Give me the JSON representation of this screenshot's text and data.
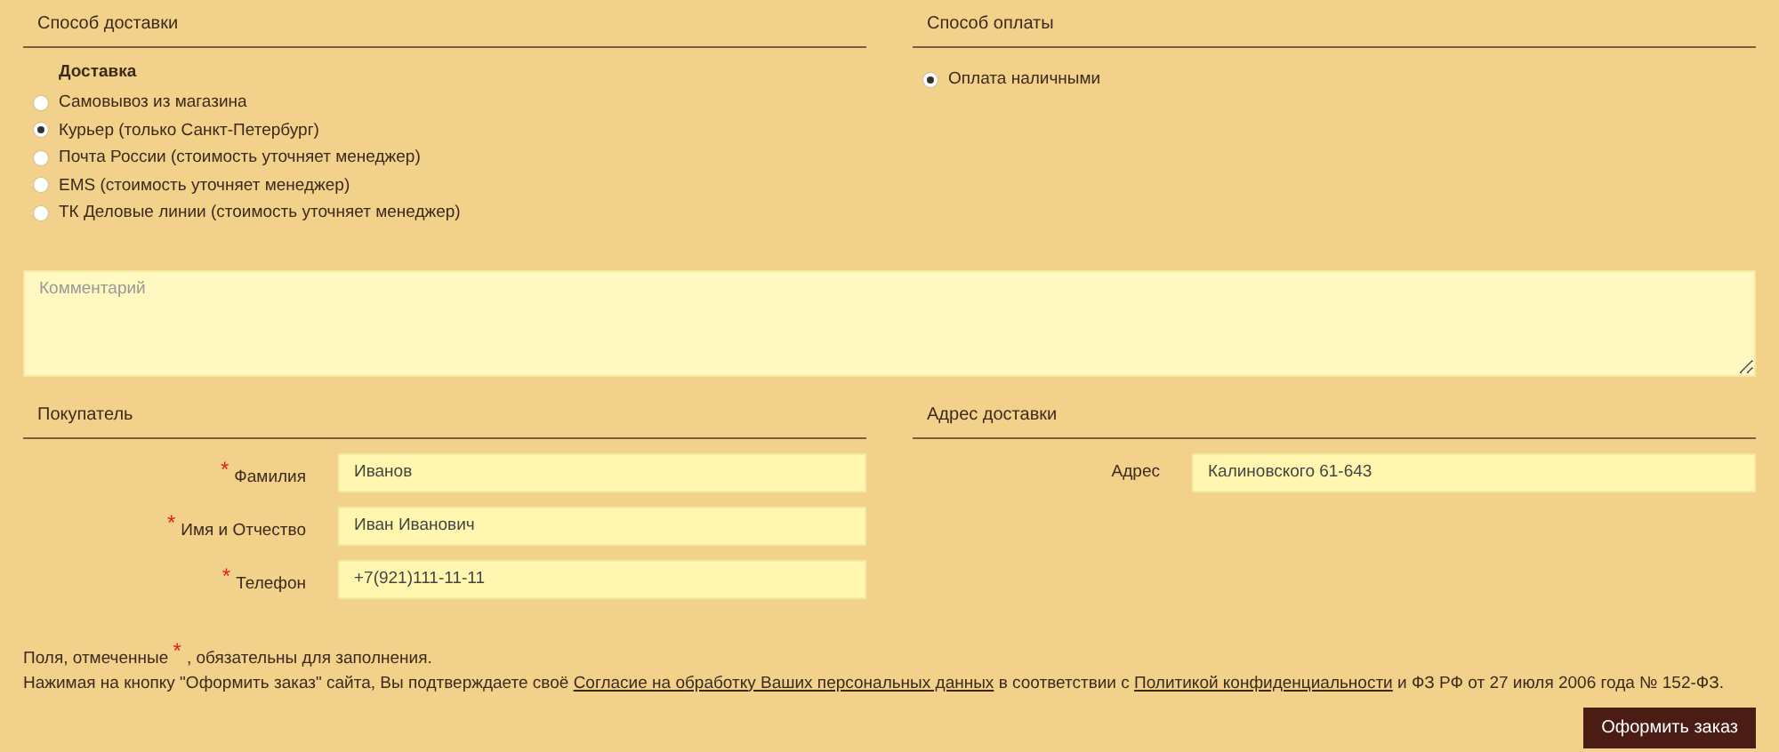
{
  "delivery": {
    "title": "Способ доставки",
    "group_label": "Доставка",
    "options": [
      {
        "label": "Самовывоз из магазина",
        "selected": false
      },
      {
        "label": "Курьер (только Санкт-Петербург)",
        "selected": true
      },
      {
        "label": "Почта России (стоимость уточняет менеджер)",
        "selected": false
      },
      {
        "label": "EMS (стоимость уточняет менеджер)",
        "selected": false
      },
      {
        "label": "ТК Деловые линии (стоимость уточняет менеджер)",
        "selected": false
      }
    ]
  },
  "payment": {
    "title": "Способ оплаты",
    "options": [
      {
        "label": "Оплата наличными",
        "selected": true
      }
    ]
  },
  "comment": {
    "placeholder": "Комментарий"
  },
  "buyer": {
    "title": "Покупатель",
    "fields": [
      {
        "required_mark": "*",
        "label": "Фамилия",
        "value": "Иванов"
      },
      {
        "required_mark": "*",
        "label": "Имя и Отчество",
        "value": "Иван Иванович"
      },
      {
        "required_mark": "*",
        "label": "Телефон",
        "value": "+7(921)111-11-11"
      }
    ]
  },
  "address": {
    "title": "Адрес доставки",
    "fields": [
      {
        "label": "Адрес",
        "value": "Калиновского 61-643"
      }
    ]
  },
  "required_note": {
    "before": "Поля, отмеченные",
    "mark": "*",
    "after": ", обязательны для заполнения."
  },
  "consent": [
    {
      "kind": "text",
      "text": "Нажимая на кнопку \"Оформить заказ\" сайта, Вы подтверждаете своё"
    },
    {
      "kind": "link",
      "text": "Согласие на обработку Ваших персональных данных"
    },
    {
      "kind": "text",
      "text": "в соответствии с"
    },
    {
      "kind": "link",
      "text": "Политикой конфиденциальности"
    },
    {
      "kind": "text",
      "text": "и ФЗ РФ от 27 июля 2006 года № 152-ФЗ."
    }
  ],
  "submit": "Оформить заказ"
}
